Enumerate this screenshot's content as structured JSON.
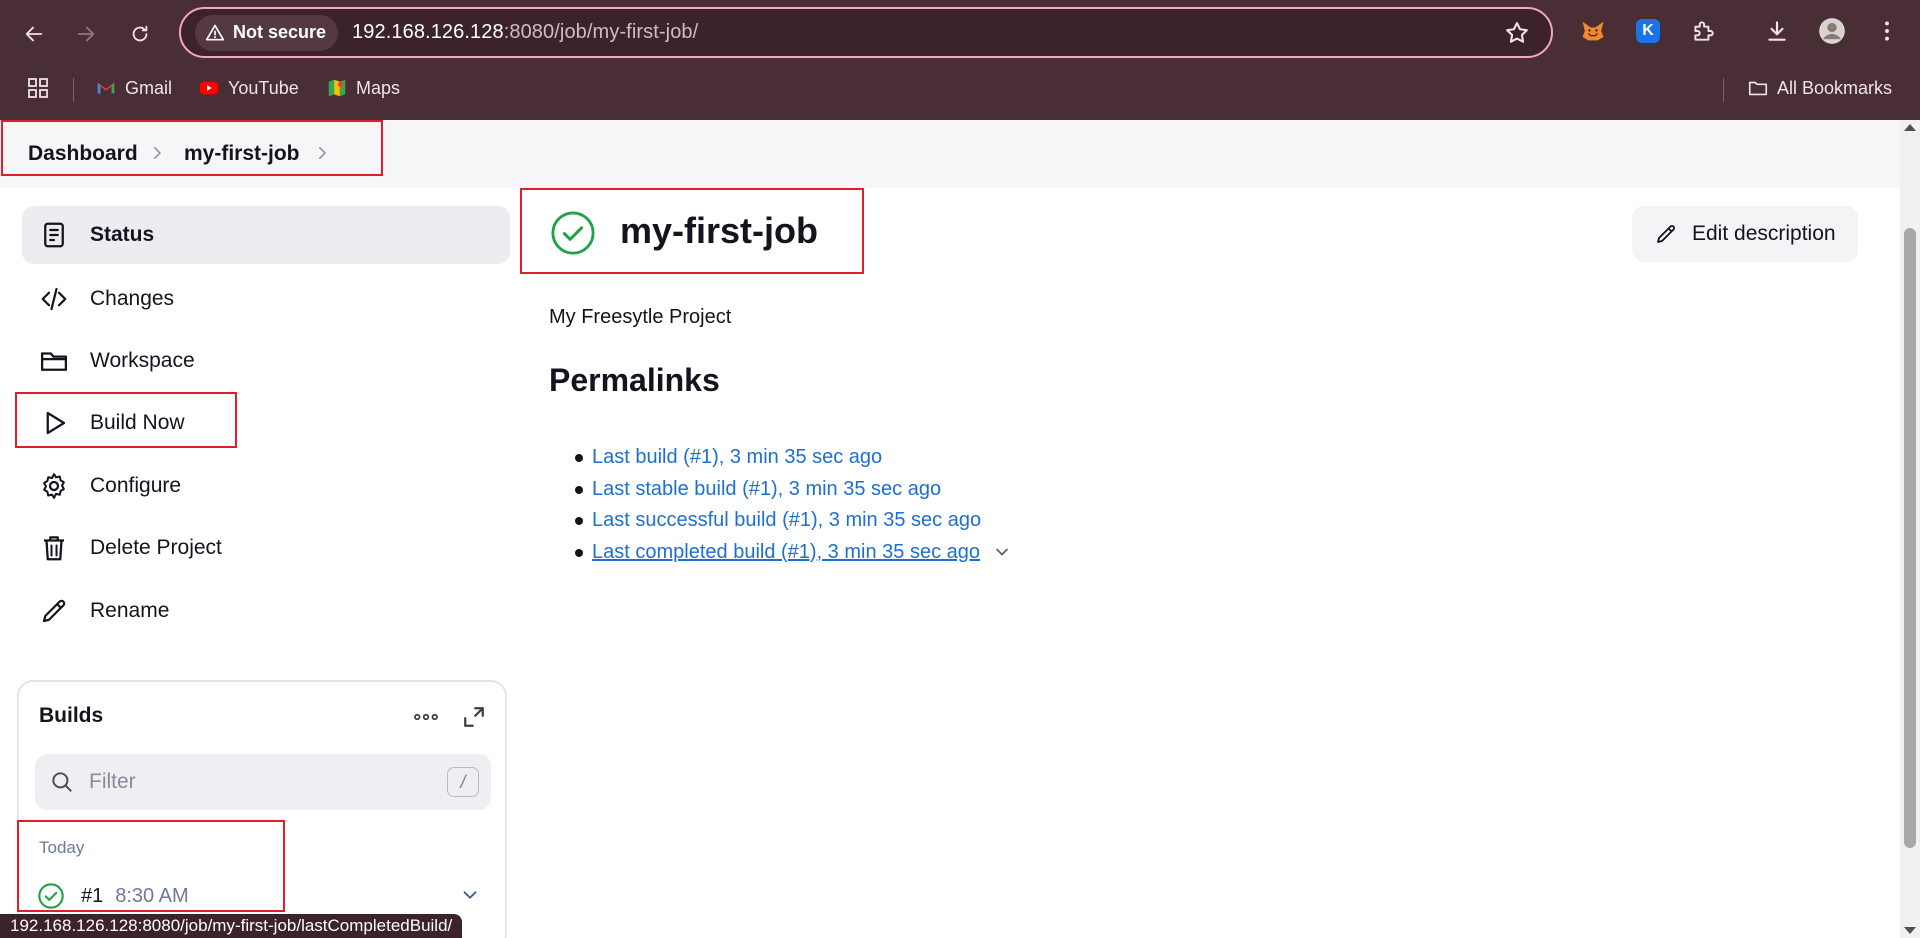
{
  "browser": {
    "security_label": "Not secure",
    "url_host": "192.168.126.128",
    "url_rest": ":8080/job/my-first-job/",
    "bookmarks": [
      {
        "label": "Gmail",
        "icon": "gmail-icon"
      },
      {
        "label": "YouTube",
        "icon": "youtube-icon"
      },
      {
        "label": "Maps",
        "icon": "maps-icon"
      }
    ],
    "all_bookmarks_label": "All Bookmarks",
    "profile_extension_letter": "K"
  },
  "breadcrumb": {
    "items": [
      "Dashboard",
      "my-first-job"
    ]
  },
  "sidebar": {
    "items": [
      {
        "label": "Status",
        "icon": "status-icon"
      },
      {
        "label": "Changes",
        "icon": "code-icon"
      },
      {
        "label": "Workspace",
        "icon": "folder-icon"
      },
      {
        "label": "Build Now",
        "icon": "play-icon"
      },
      {
        "label": "Configure",
        "icon": "gear-icon"
      },
      {
        "label": "Delete Project",
        "icon": "trash-icon"
      },
      {
        "label": "Rename",
        "icon": "pencil-icon"
      }
    ]
  },
  "builds": {
    "title": "Builds",
    "filter_placeholder": "Filter",
    "filter_shortcut": "/",
    "group_label": "Today",
    "rows": [
      {
        "number": "#1",
        "time": "8:30 AM",
        "status": "success"
      }
    ]
  },
  "main": {
    "job_name": "my-first-job",
    "edit_description_label": "Edit description",
    "description": "My Freesytle Project",
    "permalinks_title": "Permalinks",
    "permalinks": [
      "Last build (#1), 3 min 35 sec ago",
      "Last stable build (#1), 3 min 35 sec ago",
      "Last successful build (#1), 3 min 35 sec ago",
      "Last completed build (#1), 3 min 35 sec ago"
    ]
  },
  "status_bar_url": "192.168.126.128:8080/job/my-first-job/lastCompletedBuild/",
  "colors": {
    "chrome_bg": "#4a2e36",
    "omnibox_border": "#f2a7bd",
    "success_green": "#1ea446",
    "link_blue": "#1d6fd1",
    "highlight_red": "#e11d2a"
  }
}
